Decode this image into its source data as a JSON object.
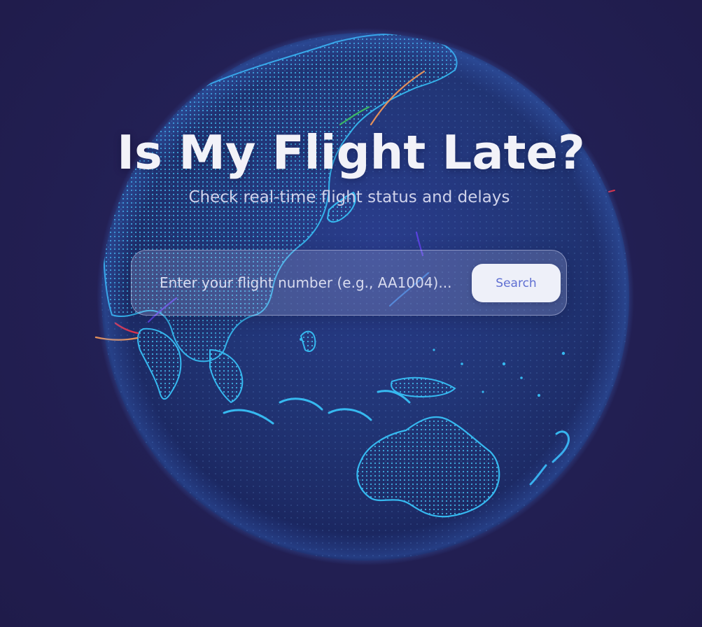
{
  "hero": {
    "title": "Is My Flight Late?",
    "subtitle": "Check real-time flight status and delays"
  },
  "search": {
    "placeholder": "Enter your flight number (e.g., AA1004)...",
    "value": "",
    "button_label": "Search"
  },
  "colors": {
    "background": "#211d4e",
    "globe": "#1e2f75",
    "coastline": "#33b8f0",
    "button_text": "#5f6fd2"
  },
  "icons": {
    "globe": "world-globe-icon"
  }
}
